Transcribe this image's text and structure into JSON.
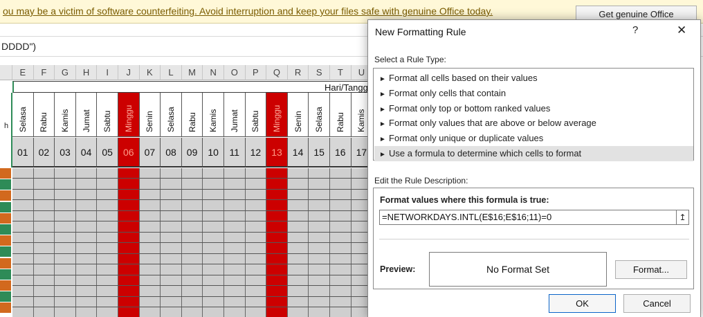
{
  "warning": {
    "message": "ou may be a victim of software counterfeiting. Avoid interruption and keep your files safe with genuine Office today.",
    "button": "Get genuine Office"
  },
  "formula_bar": {
    "text": "DDDD\")"
  },
  "columns": [
    "E",
    "F",
    "G",
    "H",
    "I",
    "J",
    "K",
    "L",
    "M",
    "N",
    "O",
    "P",
    "Q",
    "R",
    "S",
    "T",
    "U"
  ],
  "banner": {
    "text": "Hari/Tangga"
  },
  "days": [
    {
      "name": "Selasa",
      "num": "01",
      "red": false
    },
    {
      "name": "Rabu",
      "num": "02",
      "red": false
    },
    {
      "name": "Kamis",
      "num": "03",
      "red": false
    },
    {
      "name": "Jumat",
      "num": "04",
      "red": false
    },
    {
      "name": "Sabtu",
      "num": "05",
      "red": false
    },
    {
      "name": "Minggu",
      "num": "06",
      "red": true
    },
    {
      "name": "Senin",
      "num": "07",
      "red": false
    },
    {
      "name": "Selasa",
      "num": "08",
      "red": false
    },
    {
      "name": "Rabu",
      "num": "09",
      "red": false
    },
    {
      "name": "Kamis",
      "num": "10",
      "red": false
    },
    {
      "name": "Jumat",
      "num": "11",
      "red": false
    },
    {
      "name": "Sabtu",
      "num": "12",
      "red": false
    },
    {
      "name": "Minggu",
      "num": "13",
      "red": true
    },
    {
      "name": "Senin",
      "num": "14",
      "red": false
    },
    {
      "name": "Selasa",
      "num": "15",
      "red": false
    },
    {
      "name": "Rabu",
      "num": "16",
      "red": false
    },
    {
      "name": "Kamis",
      "num": "17",
      "red": false
    }
  ],
  "left_col_fragment": "h",
  "dialog": {
    "title": "New Formatting Rule",
    "help": "?",
    "close": "✕",
    "select_label": "Select a Rule Type:",
    "rule_types": [
      "Format all cells based on their values",
      "Format only cells that contain",
      "Format only top or bottom ranked values",
      "Format only values that are above or below average",
      "Format only unique or duplicate values",
      "Use a formula to determine which cells to format"
    ],
    "selected_index": 5,
    "edit_label": "Edit the Rule Description:",
    "formula_label": "Format values where this formula is true:",
    "formula_value": "=NETWORKDAYS.INTL(E$16;E$16;11)=0",
    "collapse_icon": "↥",
    "preview_label": "Preview:",
    "preview_text": "No Format Set",
    "format_button": "Format...",
    "ok_button": "OK",
    "cancel_button": "Cancel"
  },
  "colors": {
    "red": "#cc0000",
    "green": "#2e8b57",
    "orange": "#d2691e"
  }
}
